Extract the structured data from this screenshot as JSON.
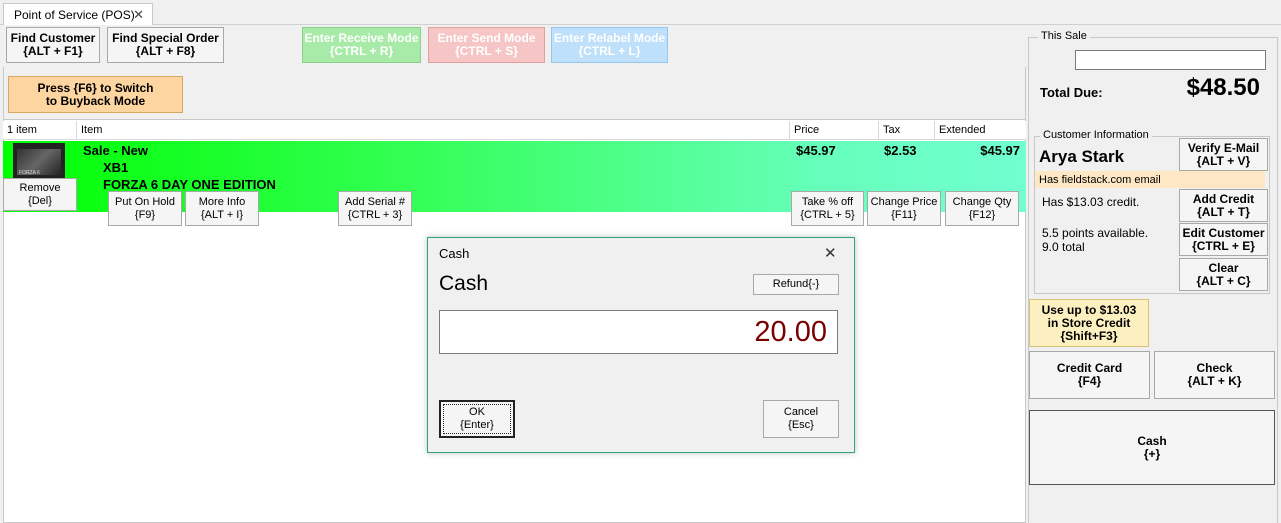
{
  "tab": {
    "title": "Point of Service (POS)",
    "close_glyph": "✕"
  },
  "toolbar": {
    "find_customer": {
      "line1": "Find Customer",
      "line2": "{ALT + F1}"
    },
    "find_special_order": {
      "line1": "Find Special Order",
      "line2": "{ALT + F8}"
    },
    "receive_mode": {
      "line1": "Enter Receive Mode",
      "line2": "{CTRL + R}"
    },
    "send_mode": {
      "line1": "Enter Send Mode",
      "line2": "{CTRL + S}"
    },
    "relabel_mode": {
      "line1": "Enter Relabel Mode",
      "line2": "{CTRL + L}"
    },
    "buyback": {
      "line1": "Press {F6} to Switch",
      "line2": "to Buyback Mode"
    }
  },
  "grid": {
    "headers": {
      "count": "1 item",
      "item": "Item",
      "price": "Price",
      "tax": "Tax",
      "extended": "Extended"
    },
    "row": {
      "type": "Sale - New",
      "platform": "XB1",
      "title": "FORZA 6 DAY ONE EDITION",
      "price": "$45.97",
      "tax": "$2.53",
      "extended": "$45.97",
      "thumb_text": "FORZA 6"
    },
    "actions": {
      "remove": {
        "line1": "Remove",
        "line2": "{Del}"
      },
      "hold": {
        "line1": "Put On Hold",
        "line2": "{F9}"
      },
      "more_info": {
        "line1": "More Info",
        "line2": "{ALT + I}"
      },
      "add_serial": {
        "line1": "Add Serial #",
        "line2": "{CTRL + 3}"
      },
      "take_pct": {
        "line1": "Take % off",
        "line2": "{CTRL + 5}"
      },
      "change_price": {
        "line1": "Change Price",
        "line2": "{F11}"
      },
      "change_qty": {
        "line1": "Change Qty",
        "line2": "{F12}"
      }
    }
  },
  "sale": {
    "label": "This Sale",
    "search_value": "",
    "total_label": "Total Due:",
    "total_value": "$48.50",
    "customer": {
      "label": "Customer Information",
      "name": "Arya Stark",
      "email_note": "Has fieldstack.com email",
      "credit": "Has $13.03 credit.",
      "points": "5.5 points available.",
      "points_total": "9.0 total"
    },
    "buttons": {
      "verify_email": {
        "line1": "Verify E-Mail",
        "line2": "{ALT + V}"
      },
      "add_credit": {
        "line1": "Add Credit",
        "line2": "{ALT + T}"
      },
      "edit_customer": {
        "line1": "Edit Customer",
        "line2": "{CTRL + E}"
      },
      "clear": {
        "line1": "Clear",
        "line2": "{ALT + C}"
      },
      "store_credit": {
        "line1": "Use up to $13.03",
        "line2": "in Store Credit",
        "line3": "{Shift+F3}"
      },
      "credit_card": {
        "line1": "Credit Card",
        "line2": "{F4}"
      },
      "check": {
        "line1": "Check",
        "line2": "{ALT + K}"
      },
      "cash": {
        "line1": "Cash",
        "line2": "{+}"
      }
    }
  },
  "dialog": {
    "title": "Cash",
    "heading": "Cash",
    "close_glyph": "✕",
    "refund": "Refund{-}",
    "amount": "20.00",
    "ok": {
      "line1": "OK",
      "line2": "{Enter}"
    },
    "cancel": {
      "line1": "Cancel",
      "line2": "{Esc}"
    }
  },
  "colors": {
    "row_gradient_start": "#00ff00",
    "row_gradient_end": "#70ffd0",
    "amount_text": "#7a0000",
    "dialog_border": "#2fa37a",
    "email_note_bg": "#fde7c4"
  }
}
